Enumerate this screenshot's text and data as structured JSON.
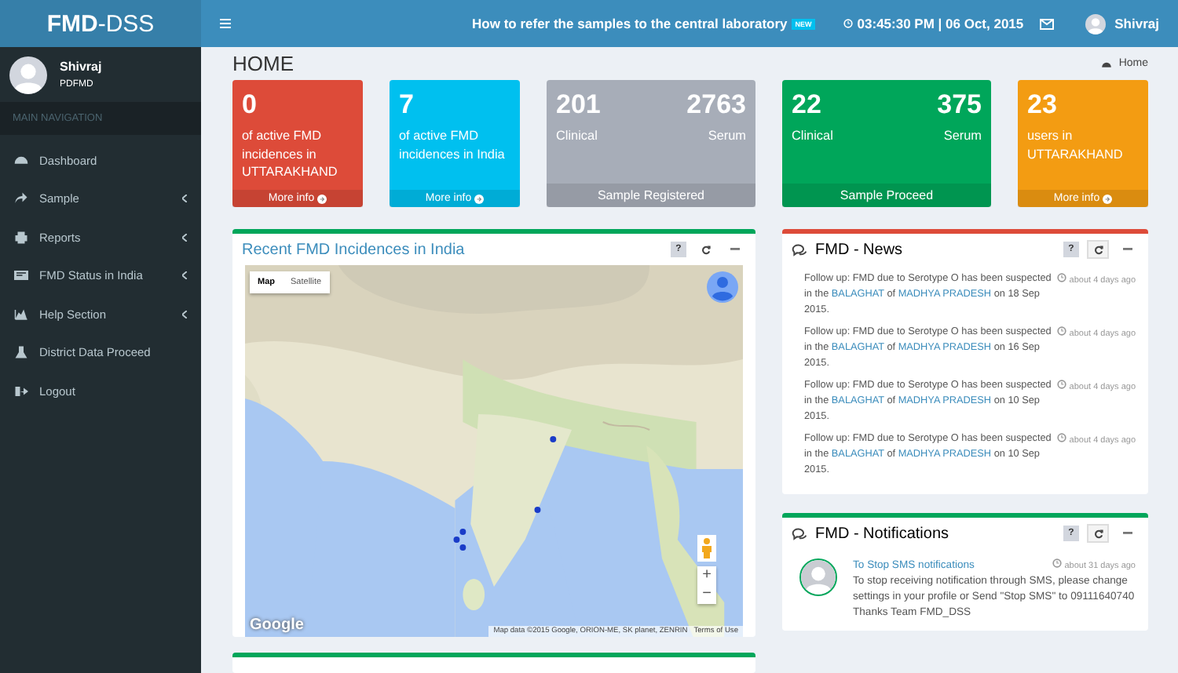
{
  "header": {
    "logo_bold": "FMD",
    "logo_rest": "-DSS",
    "announcement": "How to refer the samples to the central laboratory",
    "announcement_badge": "NEW",
    "datetime": "03:45:30 PM | 06 Oct, 2015",
    "user": "Shivraj"
  },
  "user_panel": {
    "name": "Shivraj",
    "role": "PDFMD"
  },
  "sidebar": {
    "heading": "MAIN NAVIGATION",
    "items": [
      {
        "label": "Dashboard",
        "has_submenu": false
      },
      {
        "label": "Sample",
        "has_submenu": true
      },
      {
        "label": "Reports",
        "has_submenu": true
      },
      {
        "label": "FMD Status in India",
        "has_submenu": true
      },
      {
        "label": "Help Section",
        "has_submenu": true
      },
      {
        "label": "District Data Proceed",
        "has_submenu": false
      },
      {
        "label": "Logout",
        "has_submenu": false
      }
    ]
  },
  "page": {
    "title": "HOME",
    "breadcrumb": "Home"
  },
  "stat_boxes": [
    {
      "kind": "single",
      "color": "#dd4b39",
      "value": "0",
      "text": "of active FMD incidences in UTTARAKHAND",
      "footer": "More info",
      "footer_link": true
    },
    {
      "kind": "single",
      "color": "#00c0ef",
      "value": "7",
      "text": "of active FMD incidences in India",
      "footer": "More info",
      "footer_link": true
    },
    {
      "kind": "double",
      "color": "#a7adb8",
      "values": [
        {
          "value": "201",
          "label": "Clinical"
        },
        {
          "value": "2763",
          "label": "Serum"
        }
      ],
      "footer": "Sample Registered",
      "footer_link": false
    },
    {
      "kind": "double",
      "color": "#00a65a",
      "values": [
        {
          "value": "22",
          "label": "Clinical"
        },
        {
          "value": "375",
          "label": "Serum"
        }
      ],
      "footer": "Sample Proceed",
      "footer_link": false
    },
    {
      "kind": "single",
      "color": "#f39c12",
      "value": "23",
      "text": "users in UTTARAKHAND",
      "footer": "More info",
      "footer_link": true
    }
  ],
  "map_panel": {
    "title": "Recent FMD Incidences in India",
    "help": "?",
    "map_types": [
      {
        "label": "Map",
        "selected": true
      },
      {
        "label": "Satellite",
        "selected": false
      }
    ],
    "zoom_in": "+",
    "zoom_out": "−",
    "logo": "Google",
    "attribution": "Map data ©2015 Google, ORION-ME, SK planet, ZENRIN",
    "terms": "Terms of Use"
  },
  "news_panel": {
    "title": "FMD - News",
    "help": "?",
    "items": [
      {
        "before": "Follow up: FMD due to Serotype O has been suspected in the",
        "district": "BALAGHAT",
        "middle": "of",
        "state": "MADHYA PRADESH",
        "after": "on 18 Sep 2015.",
        "time": "about 4 days ago"
      },
      {
        "before": "Follow up: FMD due to Serotype O has been suspected in the",
        "district": "BALAGHAT",
        "middle": "of",
        "state": "MADHYA PRADESH",
        "after": "on 16 Sep 2015.",
        "time": "about 4 days ago"
      },
      {
        "before": "Follow up: FMD due to Serotype O has been suspected in the",
        "district": "BALAGHAT",
        "middle": "of",
        "state": "MADHYA PRADESH",
        "after": "on 10 Sep 2015.",
        "time": "about 4 days ago"
      },
      {
        "before": "Follow up: FMD due to Serotype O has been suspected in the",
        "district": "BALAGHAT",
        "middle": "of",
        "state": "MADHYA PRADESH",
        "after": "on 10 Sep 2015.",
        "time": "about 4 days ago"
      }
    ]
  },
  "notifications_panel": {
    "title": "FMD - Notifications",
    "help": "?",
    "items": [
      {
        "title": "To Stop SMS notifications",
        "time": "about 31 days ago",
        "text": "To stop receiving notification through SMS, please change settings in your profile or Send \"Stop SMS\" to 09111640740 Thanks Team FMD_DSS"
      }
    ]
  }
}
